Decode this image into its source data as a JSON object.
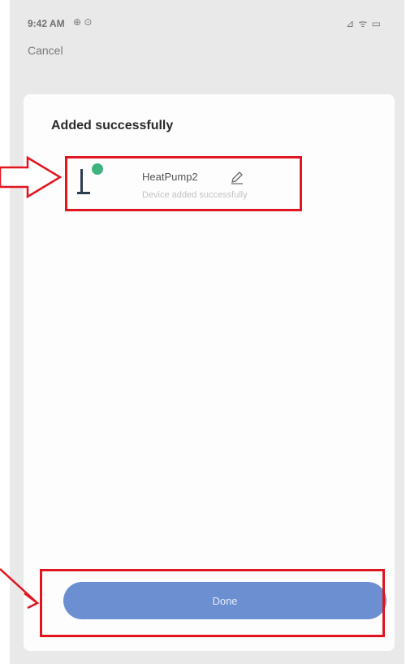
{
  "status_bar": {
    "time": "9:42 AM",
    "notification_icons": "⊕ ⊙",
    "right_icons": "⊿ ᯤ ▭"
  },
  "header": {
    "cancel_label": "Cancel"
  },
  "card": {
    "title": "Added successfully",
    "device": {
      "name": "HeatPump2",
      "status": "Device added successfully",
      "icon": "heat-pump-icon",
      "badge_color": "#3db37e"
    }
  },
  "footer": {
    "done_label": "Done"
  },
  "annotations": {
    "color": "#e0151f"
  }
}
